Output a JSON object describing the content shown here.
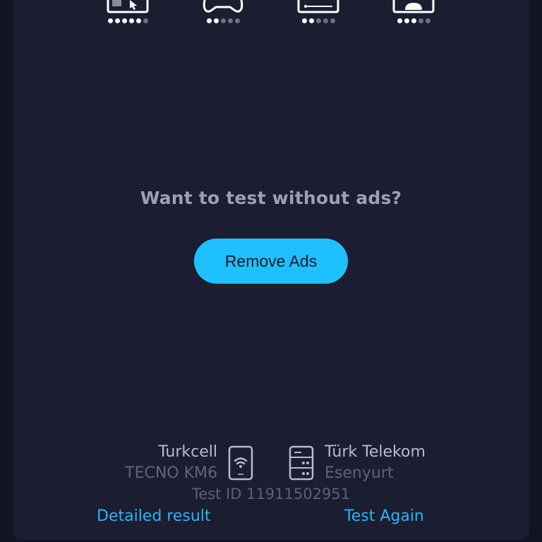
{
  "ratings": [
    {
      "icon": "browsing-icon",
      "dots_on": 5,
      "dots_total": 6
    },
    {
      "icon": "gamepad-icon",
      "dots_on": 2,
      "dots_total": 5
    },
    {
      "icon": "streaming-icon",
      "dots_on": 2,
      "dots_total": 5
    },
    {
      "icon": "video-call-icon",
      "dots_on": 3,
      "dots_total": 5
    }
  ],
  "promo": {
    "question": "Want to test without ads?",
    "button_label": "Remove Ads"
  },
  "connection": {
    "provider": "Turkcell",
    "device": "TECNO KM6",
    "server_provider": "Türk Telekom",
    "server_location": "Esenyurt",
    "test_id": "Test ID 11911502951"
  },
  "actions": {
    "detailed_result": "Detailed result",
    "test_again": "Test Again"
  },
  "colors": {
    "accent": "#1fc0ff",
    "link": "#2bb4f0",
    "background": "#1b1d31"
  }
}
